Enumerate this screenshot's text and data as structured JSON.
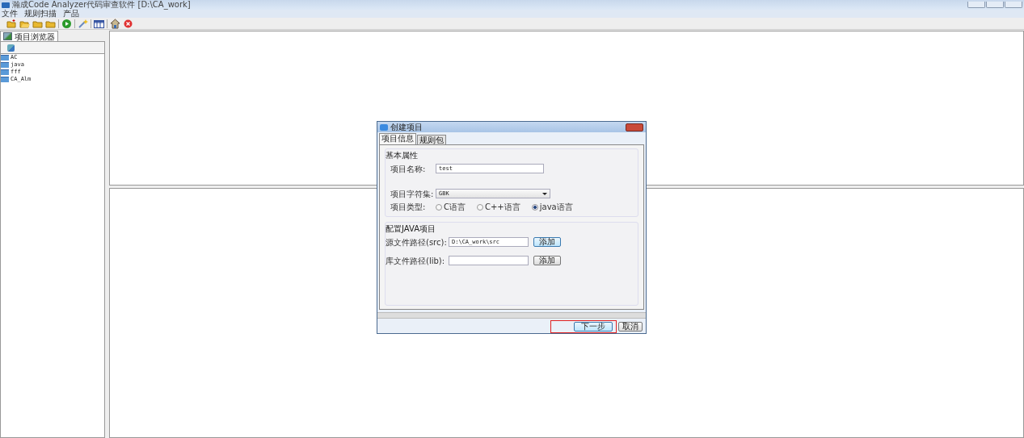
{
  "window": {
    "title": "瀚成Code Analyzer代码审查软件 [D:\\CA_work]"
  },
  "menu": [
    "文件",
    "规则扫描",
    "产品"
  ],
  "toolbar": [
    {
      "kind": "new-folder"
    },
    {
      "kind": "open-folder"
    },
    {
      "kind": "folder"
    },
    {
      "kind": "folder"
    },
    {
      "kind": "sep"
    },
    {
      "kind": "run"
    },
    {
      "kind": "sep"
    },
    {
      "kind": "wand"
    },
    {
      "kind": "sep"
    },
    {
      "kind": "grid"
    },
    {
      "kind": "sep"
    },
    {
      "kind": "home"
    },
    {
      "kind": "stop"
    }
  ],
  "sidebar": {
    "tab": "项目浏览器",
    "items": [
      "AC",
      "java",
      "fff",
      "CA_Alm"
    ]
  },
  "dialog": {
    "title": "创建项目",
    "tabs": [
      {
        "label": "项目信息",
        "selected": true
      },
      {
        "label": "规则包",
        "selected": false
      }
    ],
    "basic": {
      "legend": "基本属性",
      "name_label": "项目名称:",
      "name_value": "test",
      "charset_label": "项目字符集:",
      "charset_value": "GBK",
      "type_label": "项目类型:",
      "types": [
        {
          "label": "C语言",
          "selected": false
        },
        {
          "label": "C++语言",
          "selected": false
        },
        {
          "label": "java语言",
          "selected": true
        }
      ]
    },
    "java": {
      "legend": "配置JAVA项目",
      "rows": [
        {
          "label": "源文件路径(src):",
          "value": "D:\\CA_work\\src",
          "button": "添加",
          "focused": true
        },
        {
          "label": "库文件路径(lib):",
          "value": "",
          "button": "添加",
          "focused": false
        }
      ]
    },
    "buttons": [
      {
        "label": "下一步",
        "highlighted": true
      },
      {
        "label": "取消",
        "highlighted": false
      }
    ]
  }
}
